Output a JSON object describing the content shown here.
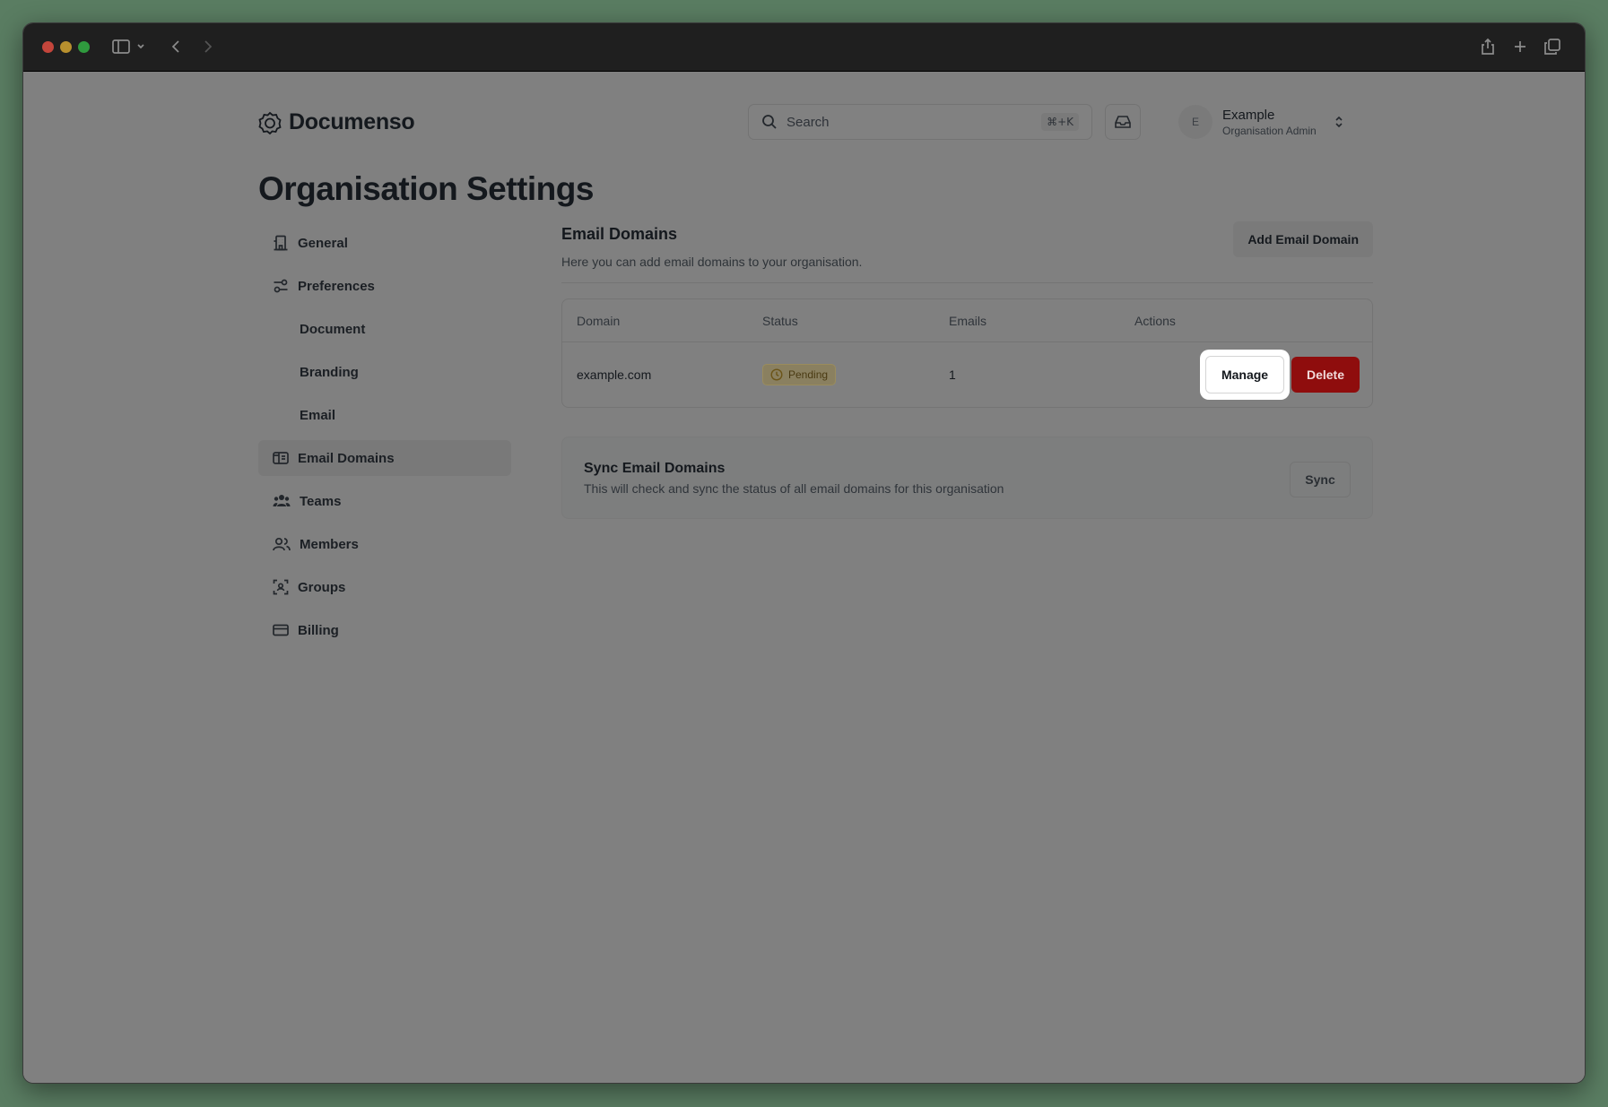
{
  "app": {
    "brand": "Documenso"
  },
  "header": {
    "search_placeholder": "Search",
    "search_shortcut": "⌘+K",
    "account": {
      "initial": "E",
      "name": "Example",
      "role": "Organisation Admin"
    }
  },
  "page": {
    "title": "Organisation Settings"
  },
  "sidebar": {
    "items": [
      {
        "label": "General",
        "icon": "building-icon"
      },
      {
        "label": "Preferences",
        "icon": "sliders-icon"
      },
      {
        "label": "Document",
        "sub": true
      },
      {
        "label": "Branding",
        "sub": true
      },
      {
        "label": "Email",
        "sub": true
      },
      {
        "label": "Email Domains",
        "icon": "mail-card-icon",
        "active": true
      },
      {
        "label": "Teams",
        "icon": "users-solid-icon"
      },
      {
        "label": "Members",
        "icon": "users-icon"
      },
      {
        "label": "Groups",
        "icon": "group-scan-icon"
      },
      {
        "label": "Billing",
        "icon": "credit-card-icon"
      }
    ]
  },
  "main": {
    "title": "Email Domains",
    "subtitle": "Here you can add email domains to your organisation.",
    "add_button": "Add Email Domain",
    "table": {
      "headers": {
        "domain": "Domain",
        "status": "Status",
        "emails": "Emails",
        "actions": "Actions"
      },
      "rows": [
        {
          "domain": "example.com",
          "status": "Pending",
          "emails": "1",
          "manage": "Manage",
          "delete": "Delete"
        }
      ]
    },
    "sync": {
      "title": "Sync Email Domains",
      "description": "This will check and sync the status of all email domains for this organisation",
      "button": "Sync"
    }
  },
  "colors": {
    "delete": "#8f0d0d",
    "pending_badge": "#8a8060",
    "overlay": "#808080"
  }
}
